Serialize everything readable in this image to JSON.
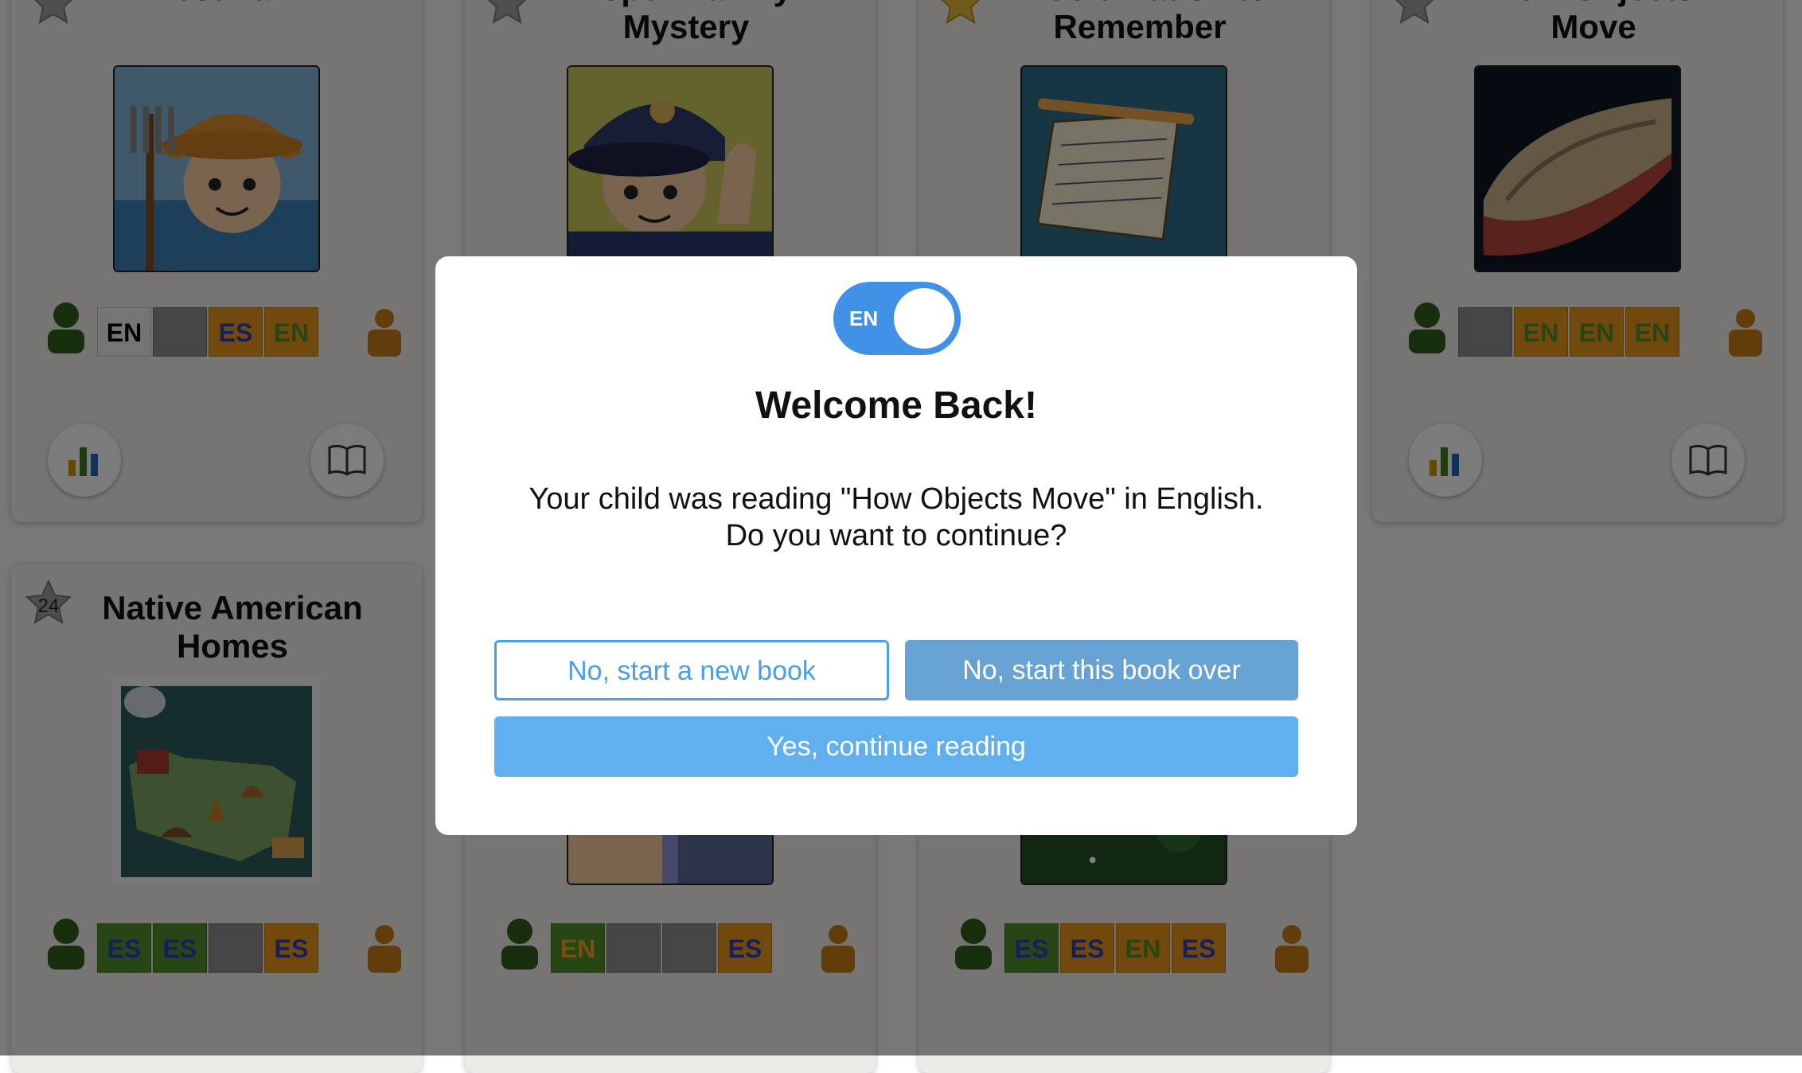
{
  "cards": [
    {
      "title_lines": [
        "Best Farm",
        ""
      ],
      "star_number": "",
      "langs": [
        [
          "EN",
          "lang-en-green"
        ],
        [
          "",
          "lang-empty"
        ],
        [
          "ES",
          "lang-es"
        ],
        [
          "EN",
          "lang-en-orange"
        ]
      ]
    },
    {
      "title_lines": [
        "Lopez Family",
        "Mystery"
      ],
      "star_number": ""
    },
    {
      "title_lines": [
        "A Celebration to",
        "Remember"
      ],
      "star_number": ""
    },
    {
      "title_lines": [
        "How Objects",
        "Move"
      ],
      "star_number": "",
      "langs": [
        [
          "",
          "lang-empty"
        ],
        [
          "EN",
          "lang-en-orange"
        ],
        [
          "EN",
          "lang-en-orange"
        ],
        [
          "EN",
          "lang-en-orange"
        ]
      ]
    },
    {
      "title_lines": [
        "Native American",
        "Homes"
      ],
      "star_number": "24",
      "langs": [
        [
          "ES",
          "lang-es-green"
        ],
        [
          "ES",
          "lang-es-green"
        ],
        [
          "",
          "lang-empty"
        ],
        [
          "ES",
          "lang-es"
        ]
      ]
    },
    {
      "title_lines": [
        "",
        ""
      ],
      "star_number": "",
      "langs": [
        [
          "EN",
          "lang-en-green"
        ],
        [
          "",
          "lang-empty"
        ],
        [
          "",
          "lang-empty"
        ],
        [
          "ES",
          "lang-es"
        ]
      ]
    },
    {
      "title_lines": [
        "",
        ""
      ],
      "star_number": "",
      "langs": [
        [
          "ES",
          "lang-es-green"
        ],
        [
          "ES",
          "lang-es"
        ],
        [
          "EN",
          "lang-en-orange"
        ],
        [
          "ES",
          "lang-es"
        ]
      ]
    }
  ],
  "modal": {
    "toggle_label": "EN",
    "title": "Welcome Back!",
    "message_line1": "Your child was reading \"How Objects Move\" in English.",
    "message_line2": "Do you want to continue?",
    "btn_new_book": "No, start a new book",
    "btn_start_over": "No, start this book over",
    "btn_continue": "Yes, continue reading"
  },
  "colors": {
    "toggle": "#3f92e5",
    "continue_button": "#60b0ef",
    "start_over_button": "#66a2d3",
    "outline_button": "#4aa0e8"
  },
  "icons": [
    "star-icon",
    "child-progress-icon",
    "parent-progress-icon",
    "stats-icon",
    "book-icon"
  ]
}
